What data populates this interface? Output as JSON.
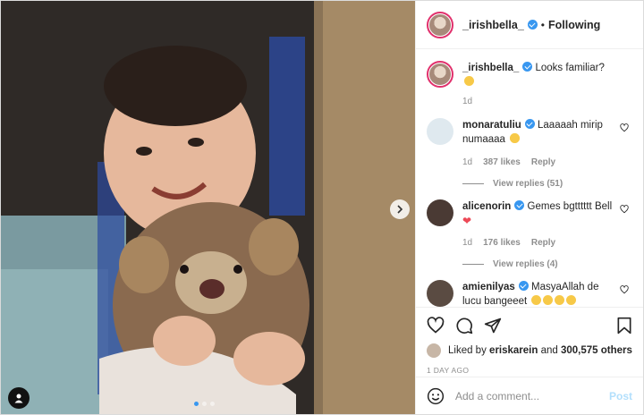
{
  "header": {
    "username": "_irishbella_",
    "separator": "•",
    "follow_status": "Following"
  },
  "caption": {
    "username": "_irishbella_",
    "text": "Looks familiar?",
    "time": "1d"
  },
  "comments": [
    {
      "username": "monaratuliu",
      "text": "Laaaaah mirip numaaaa",
      "time": "1d",
      "likes": "387 likes",
      "reply_label": "Reply",
      "view_replies": "View replies (51)"
    },
    {
      "username": "alicenorin",
      "text": "Gemes bgtttttt Bell",
      "time": "1d",
      "likes": "176 likes",
      "reply_label": "Reply",
      "view_replies": "View replies (4)"
    },
    {
      "username": "amienilyas",
      "text": "MasyaAllah de lucu bangeeet"
    }
  ],
  "likes": {
    "prefix": "Liked by",
    "user": "eriskarein",
    "conj": "and",
    "count": "300,575 others"
  },
  "timestamp": "1 DAY AGO",
  "comment_box": {
    "placeholder": "Add a comment...",
    "post_label": "Post"
  },
  "colors": {
    "verified": "#3897f0",
    "story_ring": "#e1306c",
    "post_disabled": "#b2dffc",
    "heart_emoji": "#ed4956"
  },
  "icons": [
    "heart-icon",
    "comment-icon",
    "share-icon",
    "bookmark-icon",
    "emoji-icon",
    "chevron-right-icon",
    "user-tag-icon",
    "verified-icon"
  ],
  "carousel": {
    "slides": 3,
    "active_slide": 1
  }
}
